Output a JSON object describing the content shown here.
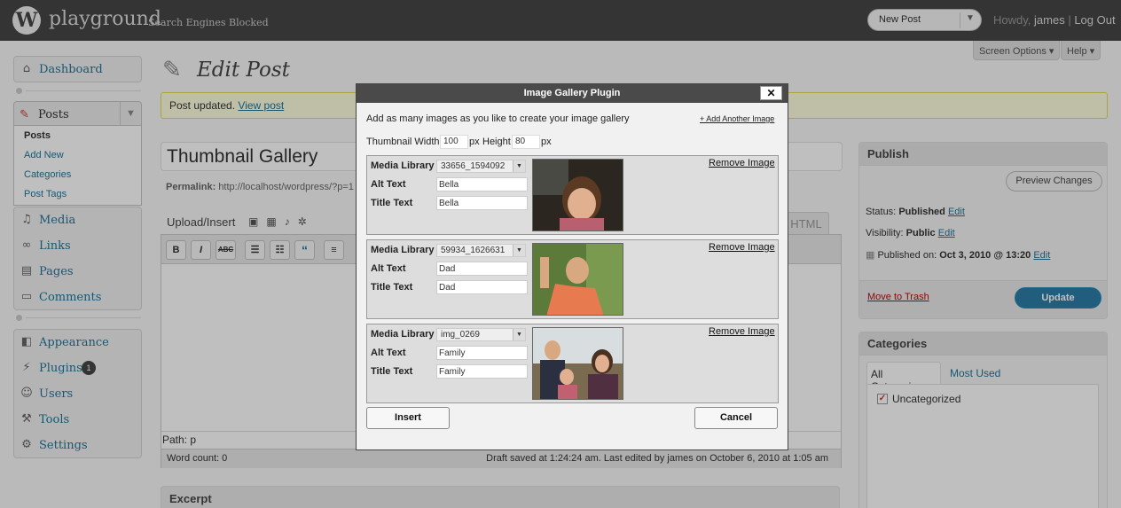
{
  "header": {
    "logo_glyph": "W",
    "site_name": "playground",
    "blocked_notice": "Search Engines Blocked",
    "new_post_label": "New Post",
    "howdy_prefix": "Howdy,",
    "username": "james",
    "logout": "Log Out"
  },
  "screen_tabs": {
    "screen_options": "Screen Options ▾",
    "help": "Help ▾"
  },
  "menu": {
    "dashboard": "Dashboard",
    "posts": "Posts",
    "posts_sub": [
      "Posts",
      "Add New",
      "Categories",
      "Post Tags"
    ],
    "media": "Media",
    "links": "Links",
    "pages": "Pages",
    "comments": "Comments",
    "appearance": "Appearance",
    "plugins": "Plugins",
    "plugins_badge": "1",
    "users": "Users",
    "tools": "Tools",
    "settings": "Settings"
  },
  "page": {
    "title": "Edit Post",
    "notice_text": "Post updated.",
    "notice_link": "View post",
    "post_title": "Thumbnail Gallery",
    "permalink_label": "Permalink:",
    "permalink_url": "http://localhost/wordpress/?p=1",
    "upload_insert": "Upload/Insert",
    "html_tab": "HTML",
    "path_label": "Path:",
    "path_value": "p",
    "word_count": "Word count: 0",
    "draft_saved": "Draft saved at 1:24:24 am. Last edited by james on October 6, 2010 at 1:05 am",
    "excerpt": "Excerpt"
  },
  "publish": {
    "title": "Publish",
    "preview": "Preview Changes",
    "status_label": "Status:",
    "status_value": "Published",
    "visibility_label": "Visibility:",
    "visibility_value": "Public",
    "published_label": "Published on:",
    "published_value": "Oct 3, 2010 @ 13:20",
    "edit": "Edit",
    "trash": "Move to Trash",
    "update": "Update"
  },
  "categories": {
    "title": "Categories",
    "tab_all": "All Categories",
    "tab_used": "Most Used",
    "items": [
      {
        "label": "Uncategorized",
        "checked": true
      }
    ]
  },
  "modal": {
    "title": "Image Gallery Plugin",
    "close": "✕",
    "intro": "Add as many images as you like to create your image gallery",
    "add_another": "+ Add Another Image",
    "thumb_width_label": "Thumbnail Width",
    "thumb_width": "100",
    "px": "px",
    "height_label": "Height",
    "thumb_height": "80",
    "labels": {
      "media": "Media Library",
      "alt": "Alt Text",
      "title": "Title Text",
      "remove": "Remove Image"
    },
    "images": [
      {
        "media": "33656_1594092",
        "alt": "Bella",
        "title": "Bella"
      },
      {
        "media": "59934_1626631",
        "alt": "Dad",
        "title": "Dad"
      },
      {
        "media": "img_0269",
        "alt": "Family",
        "title": "Family"
      }
    ],
    "insert": "Insert",
    "cancel": "Cancel"
  }
}
